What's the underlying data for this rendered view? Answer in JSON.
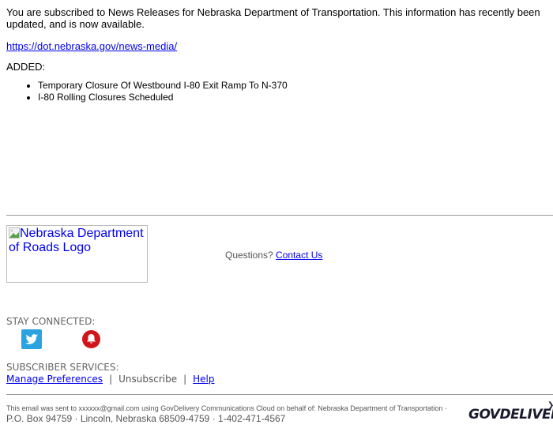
{
  "intro": "You are subscribed to News Releases for Nebraska Department of Transportation. This information has recently been updated, and is now available.",
  "main_link": "https://dot.nebraska.gov/news-media/",
  "added_label": "ADDED:",
  "items": [
    "Temporary Closure Of Westbound I-80 Exit Ramp To N-370",
    "I-80 Rolling Closures Scheduled"
  ],
  "logo_alt": "Nebraska Department of Roads Logo",
  "questions": {
    "label": "Questions?",
    "link": "Contact Us"
  },
  "stay_connected": "STAY CONNECTED:",
  "social": [
    {
      "name": "twitter",
      "icon": "twitter-icon",
      "color": "#2aa3e0"
    },
    {
      "name": "notifications",
      "icon": "bell-icon",
      "color": "#d0161b"
    }
  ],
  "subscriber_services": {
    "label": "SUBSCRIBER SERVICES:",
    "manage": "Manage Preferences",
    "separator": "|",
    "unsubscribe": "Unsubscribe",
    "help": "Help"
  },
  "footer": {
    "sent_text": "This email was sent to xxxxxx@gmail.com using GovDelivery Communications Cloud on behalf of: Nebraska Department of Transportation",
    "address_sep": " · ",
    "address": "P.O. Box 94759 · Lincoln, Nebraska 68509-4759 · 1-402-471-4567",
    "brand": "GOVDELIVERY"
  }
}
